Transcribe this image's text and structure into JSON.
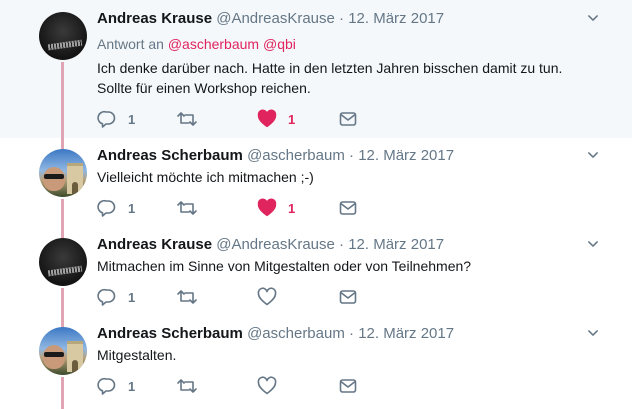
{
  "tweets": [
    {
      "author_name": "Andreas Krause",
      "author_handle": "@AndreasKrause",
      "dot": "·",
      "date": "12. März 2017",
      "reply_to_prefix": "Antwort an",
      "reply_to_mentions": [
        "@ascherbaum",
        "@qbi"
      ],
      "text_lines": [
        "Ich denke darüber nach. Hatte in den letzten Jahren bisschen damit zu tun.",
        "Sollte für einen Workshop reichen."
      ],
      "replies": "1",
      "retweets": "",
      "likes": "1",
      "liked": true,
      "avatar": "krause"
    },
    {
      "author_name": "Andreas Scherbaum",
      "author_handle": "@ascherbaum",
      "dot": "·",
      "date": "12. März 2017",
      "text_lines": [
        "Vielleicht möchte ich mitmachen ;-)"
      ],
      "replies": "1",
      "retweets": "",
      "likes": "1",
      "liked": true,
      "avatar": "scherbaum"
    },
    {
      "author_name": "Andreas Krause",
      "author_handle": "@AndreasKrause",
      "dot": "·",
      "date": "12. März 2017",
      "text_lines": [
        "Mitmachen im Sinne von Mitgestalten oder von Teilnehmen?"
      ],
      "replies": "1",
      "retweets": "",
      "likes": "",
      "liked": false,
      "avatar": "krause"
    },
    {
      "author_name": "Andreas Scherbaum",
      "author_handle": "@ascherbaum",
      "dot": "·",
      "date": "12. März 2017",
      "text_lines": [
        "Mitgestalten."
      ],
      "replies": "1",
      "retweets": "",
      "likes": "",
      "liked": false,
      "avatar": "scherbaum"
    }
  ],
  "colors": {
    "like_active": "#e0245e",
    "icon": "#657786",
    "thread_line": "#e1a4b4",
    "mention": "#e0245e"
  },
  "icons": [
    "reply-icon",
    "retweet-icon",
    "heart-icon",
    "mail-icon",
    "chevron-down-icon"
  ]
}
